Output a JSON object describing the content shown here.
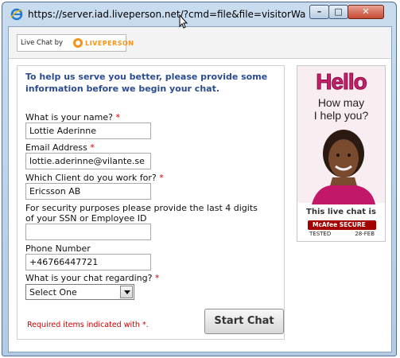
{
  "window": {
    "title": "https://server.iad.liveperson.net/?cmd=file&file=visitorWantsTo...",
    "minimize_label": "–",
    "maximize_label": "□",
    "close_label": "✕"
  },
  "brand": {
    "live_chat_by": "Live Chat by",
    "liveperson": "LIVEPERSON"
  },
  "form": {
    "intro": "To help us serve you better, please provide some information before we begin your chat.",
    "required_mark": "*",
    "name_label": "What is your name?",
    "name_value": "Lottie Aderinne",
    "email_label": "Email Address",
    "email_value": "lottie.aderinne@vilante.se",
    "client_label": "Which Client do you work for?",
    "client_value": "Ericsson AB",
    "ssn_label_1": "For security purposes please provide the last 4 digits",
    "ssn_label_2": "of your SSN or Employee ID",
    "ssn_value": "",
    "phone_label": "Phone Number",
    "phone_value": "+46766447721",
    "regarding_label": "What is your chat regarding?",
    "regarding_selected": "Select One",
    "required_note": "Required items indicated with *.",
    "start_button": "Start Chat"
  },
  "ad": {
    "hello": "Hello",
    "how_may": "How may",
    "help_you": "I help you?",
    "live_chat_is": "This live chat is",
    "mcafee": "McAfee SECURE",
    "tested": "TESTED",
    "date": "28-FEB"
  },
  "colors": {
    "intro_text": "#2b4c8f",
    "required": "#cc0000",
    "hello": "#c6206c",
    "liveperson_orange": "#f7941d"
  }
}
